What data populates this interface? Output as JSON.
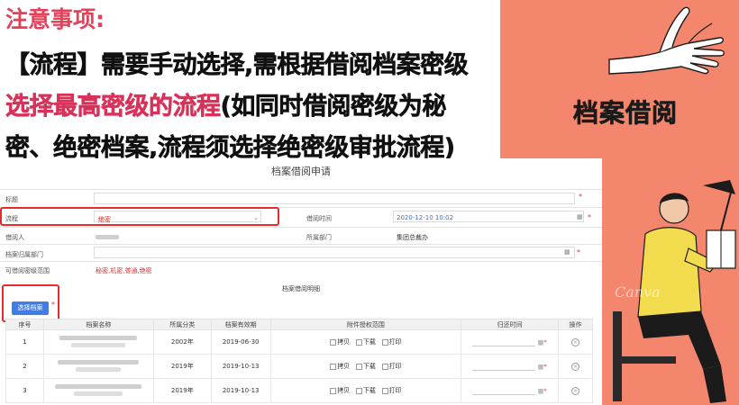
{
  "notes": {
    "title": "注意事项:",
    "line1": "【流程】需要手动选择,需根据借阅档案密级",
    "line2_highlight": "选择最高密级的流程",
    "line2_rest": "(如同时借阅密级为秘",
    "line3": "密、绝密档案,流程须选择绝密级审批流程)"
  },
  "side": {
    "title": "档案借阅",
    "illustration_watermark": "Canva"
  },
  "form": {
    "title": "档案借阅申请",
    "fields": {
      "subject_label": "标题",
      "process_label": "流程",
      "process_value": "绝密",
      "borrow_time_label": "借阅时间",
      "borrow_time_value": "2020-12-10 10:02",
      "borrower_label": "借阅人",
      "department_label": "所属部门",
      "department_value": "集团总裁办",
      "archive_dept_label": "档案归属部门",
      "scope_label": "可借阅密级范围",
      "scope_value": "秘密,机密,普通,绝密"
    },
    "detail_section_title": "档案借阅明细",
    "choose_button": "选择档案",
    "table": {
      "headers": [
        "序号",
        "档案名称",
        "所属分类",
        "档案有效期",
        "附件授权范围",
        "归还时间",
        "操作"
      ],
      "permissions": [
        "拷贝",
        "下载",
        "打印"
      ],
      "rows": [
        {
          "no": "1",
          "category": "2002年",
          "expiry": "2019-06-30"
        },
        {
          "no": "2",
          "category": "2019年",
          "expiry": "2019-10-13"
        },
        {
          "no": "3",
          "category": "2019年",
          "expiry": "2019-10-13"
        }
      ]
    }
  },
  "colors": {
    "panel": "#f3866c",
    "accent_red": "#e52b2b",
    "note_pink": "#d8325a",
    "button_blue": "#3f7ee8"
  }
}
